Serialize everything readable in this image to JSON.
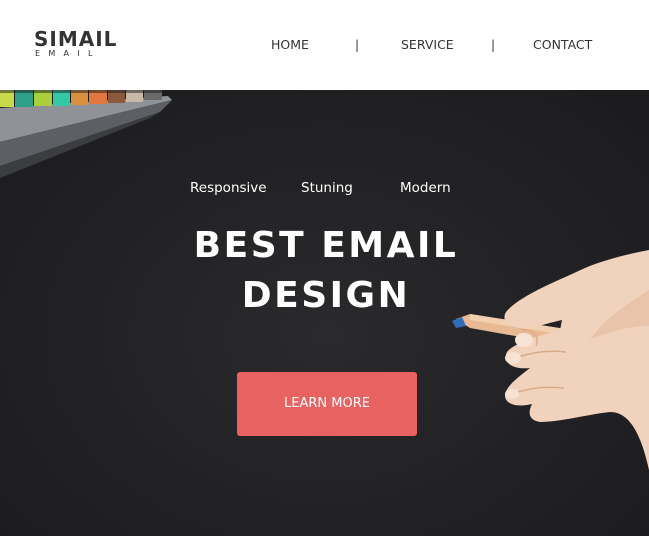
{
  "header": {
    "logo_main": "SIMAIL",
    "logo_sub": "EMAIL",
    "nav": {
      "home": "HOME",
      "service": "SERVICE",
      "contact": "CONTACT",
      "separator": "|"
    }
  },
  "hero": {
    "taglines": [
      "Responsive",
      "Stuning",
      "Modern"
    ],
    "headline_line1": "BEST EMAIL",
    "headline_line2": "DESIGN",
    "cta_label": "LEARN MORE"
  },
  "colors": {
    "accent": "#e96262",
    "hero_background": "#232325",
    "text_dark": "#333333"
  },
  "icons": [
    "colored-pencils-tray-image",
    "hand-with-pencil-image"
  ]
}
